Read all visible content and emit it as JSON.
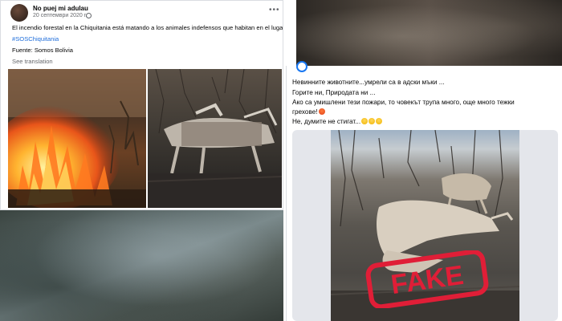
{
  "left_post": {
    "author": "No puej mi adulau",
    "date": "20 септември 2020 г.",
    "text": "El incendio forestal en la Chiquitania está matando a los animales indefensos que habitan en el lugar.",
    "hashtag": "#SOSChiquitania",
    "source": "Fuente: Somos Bolivia",
    "translate": "See translation",
    "more_icon": "more-horizontal-icon"
  },
  "right_post": {
    "lines": [
      "Невинните животните...умрели са в адски мъки ...",
      "Горите ни, Природата ни ...",
      "Ако са умишлени тези пожари, то човекът трупа много, още много тежки",
      "грехове!",
      "Не, думите не стигат..."
    ],
    "fake_stamp": "FAKE",
    "stamp_color": "#e01e37"
  }
}
